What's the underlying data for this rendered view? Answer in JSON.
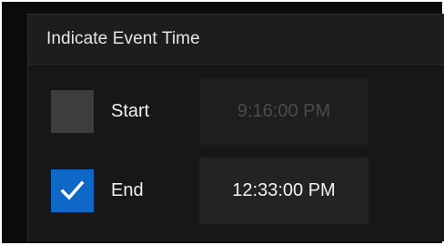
{
  "panel": {
    "title": "Indicate Event Time"
  },
  "start": {
    "label": "Start",
    "checked": false,
    "time": "9:16:00 PM"
  },
  "end": {
    "label": "End",
    "checked": true,
    "time": "12:33:00 PM"
  },
  "colors": {
    "accent": "#1068c6",
    "panel_bg": "#171717",
    "disabled_text": "#4b4b4b"
  },
  "icons": {
    "check": "checkmark-icon"
  }
}
